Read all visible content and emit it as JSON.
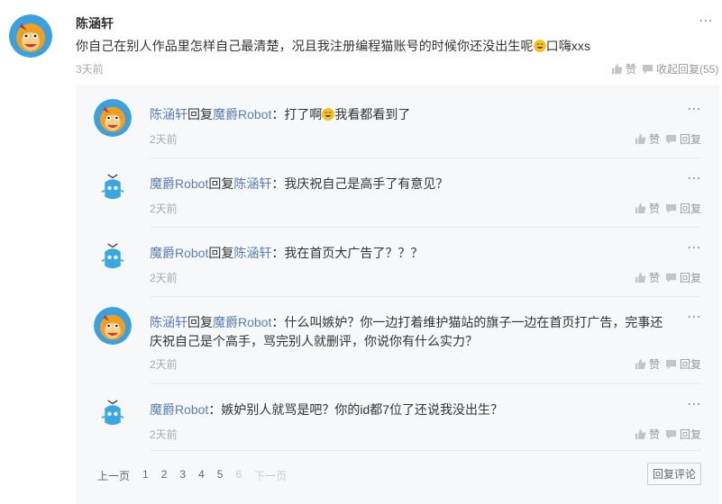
{
  "main_comment": {
    "author": "陈涵轩",
    "text": "你自己在别人作品里怎样自己最清楚，况且我注册编程猫账号的时候你还没出生呢",
    "text_suffix": "口嗨xxs",
    "time": "3天前",
    "like_label": "赞",
    "collapse_label": "收起回复(55)",
    "more_icon": "⋯"
  },
  "replies": [
    {
      "author": "陈涵轩",
      "verb": "回复",
      "target": "魔爵Robot",
      "colon": "：",
      "text": "打了啊",
      "text_suffix": "我看都看到了",
      "has_emoji": true,
      "time": "2天前",
      "like_label": "赞",
      "reply_label": "回复"
    },
    {
      "author": "魔爵Robot",
      "verb": "回复",
      "target": "陈涵轩",
      "colon": "：",
      "text": "我庆祝自己是高手了有意见？",
      "text_suffix": "",
      "has_emoji": false,
      "time": "2天前",
      "like_label": "赞",
      "reply_label": "回复"
    },
    {
      "author": "魔爵Robot",
      "verb": "回复",
      "target": "陈涵轩",
      "colon": "：",
      "text": "我在首页大广告了？？？",
      "text_suffix": "",
      "has_emoji": false,
      "time": "2天前",
      "like_label": "赞",
      "reply_label": "回复"
    },
    {
      "author": "陈涵轩",
      "verb": "回复",
      "target": "魔爵Robot",
      "colon": "：",
      "text": "什么叫嫉妒？你一边打着维护猫站的旗子一边在首页打广告，完事还庆祝自己是个高手，骂完别人就删评，你说你有什么实力？",
      "text_suffix": "",
      "has_emoji": false,
      "time": "2天前",
      "like_label": "赞",
      "reply_label": "回复"
    },
    {
      "author": "魔爵Robot",
      "verb": "",
      "target": "",
      "colon": "：",
      "text": "嫉妒别人就骂是吧？你的id都7位了还说我没出生？",
      "text_suffix": "",
      "has_emoji": false,
      "time": "2天前",
      "like_label": "赞",
      "reply_label": "回复"
    }
  ],
  "pagination": {
    "prev": "上一页",
    "pages": [
      "1",
      "2",
      "3",
      "4",
      "5",
      "6"
    ],
    "next": "下一页"
  },
  "reply_comment_button": "回复评论",
  "colors": {
    "link": "#5b7fb4",
    "panel_bg": "#f7f8fa",
    "meta": "#aaaaaa"
  }
}
